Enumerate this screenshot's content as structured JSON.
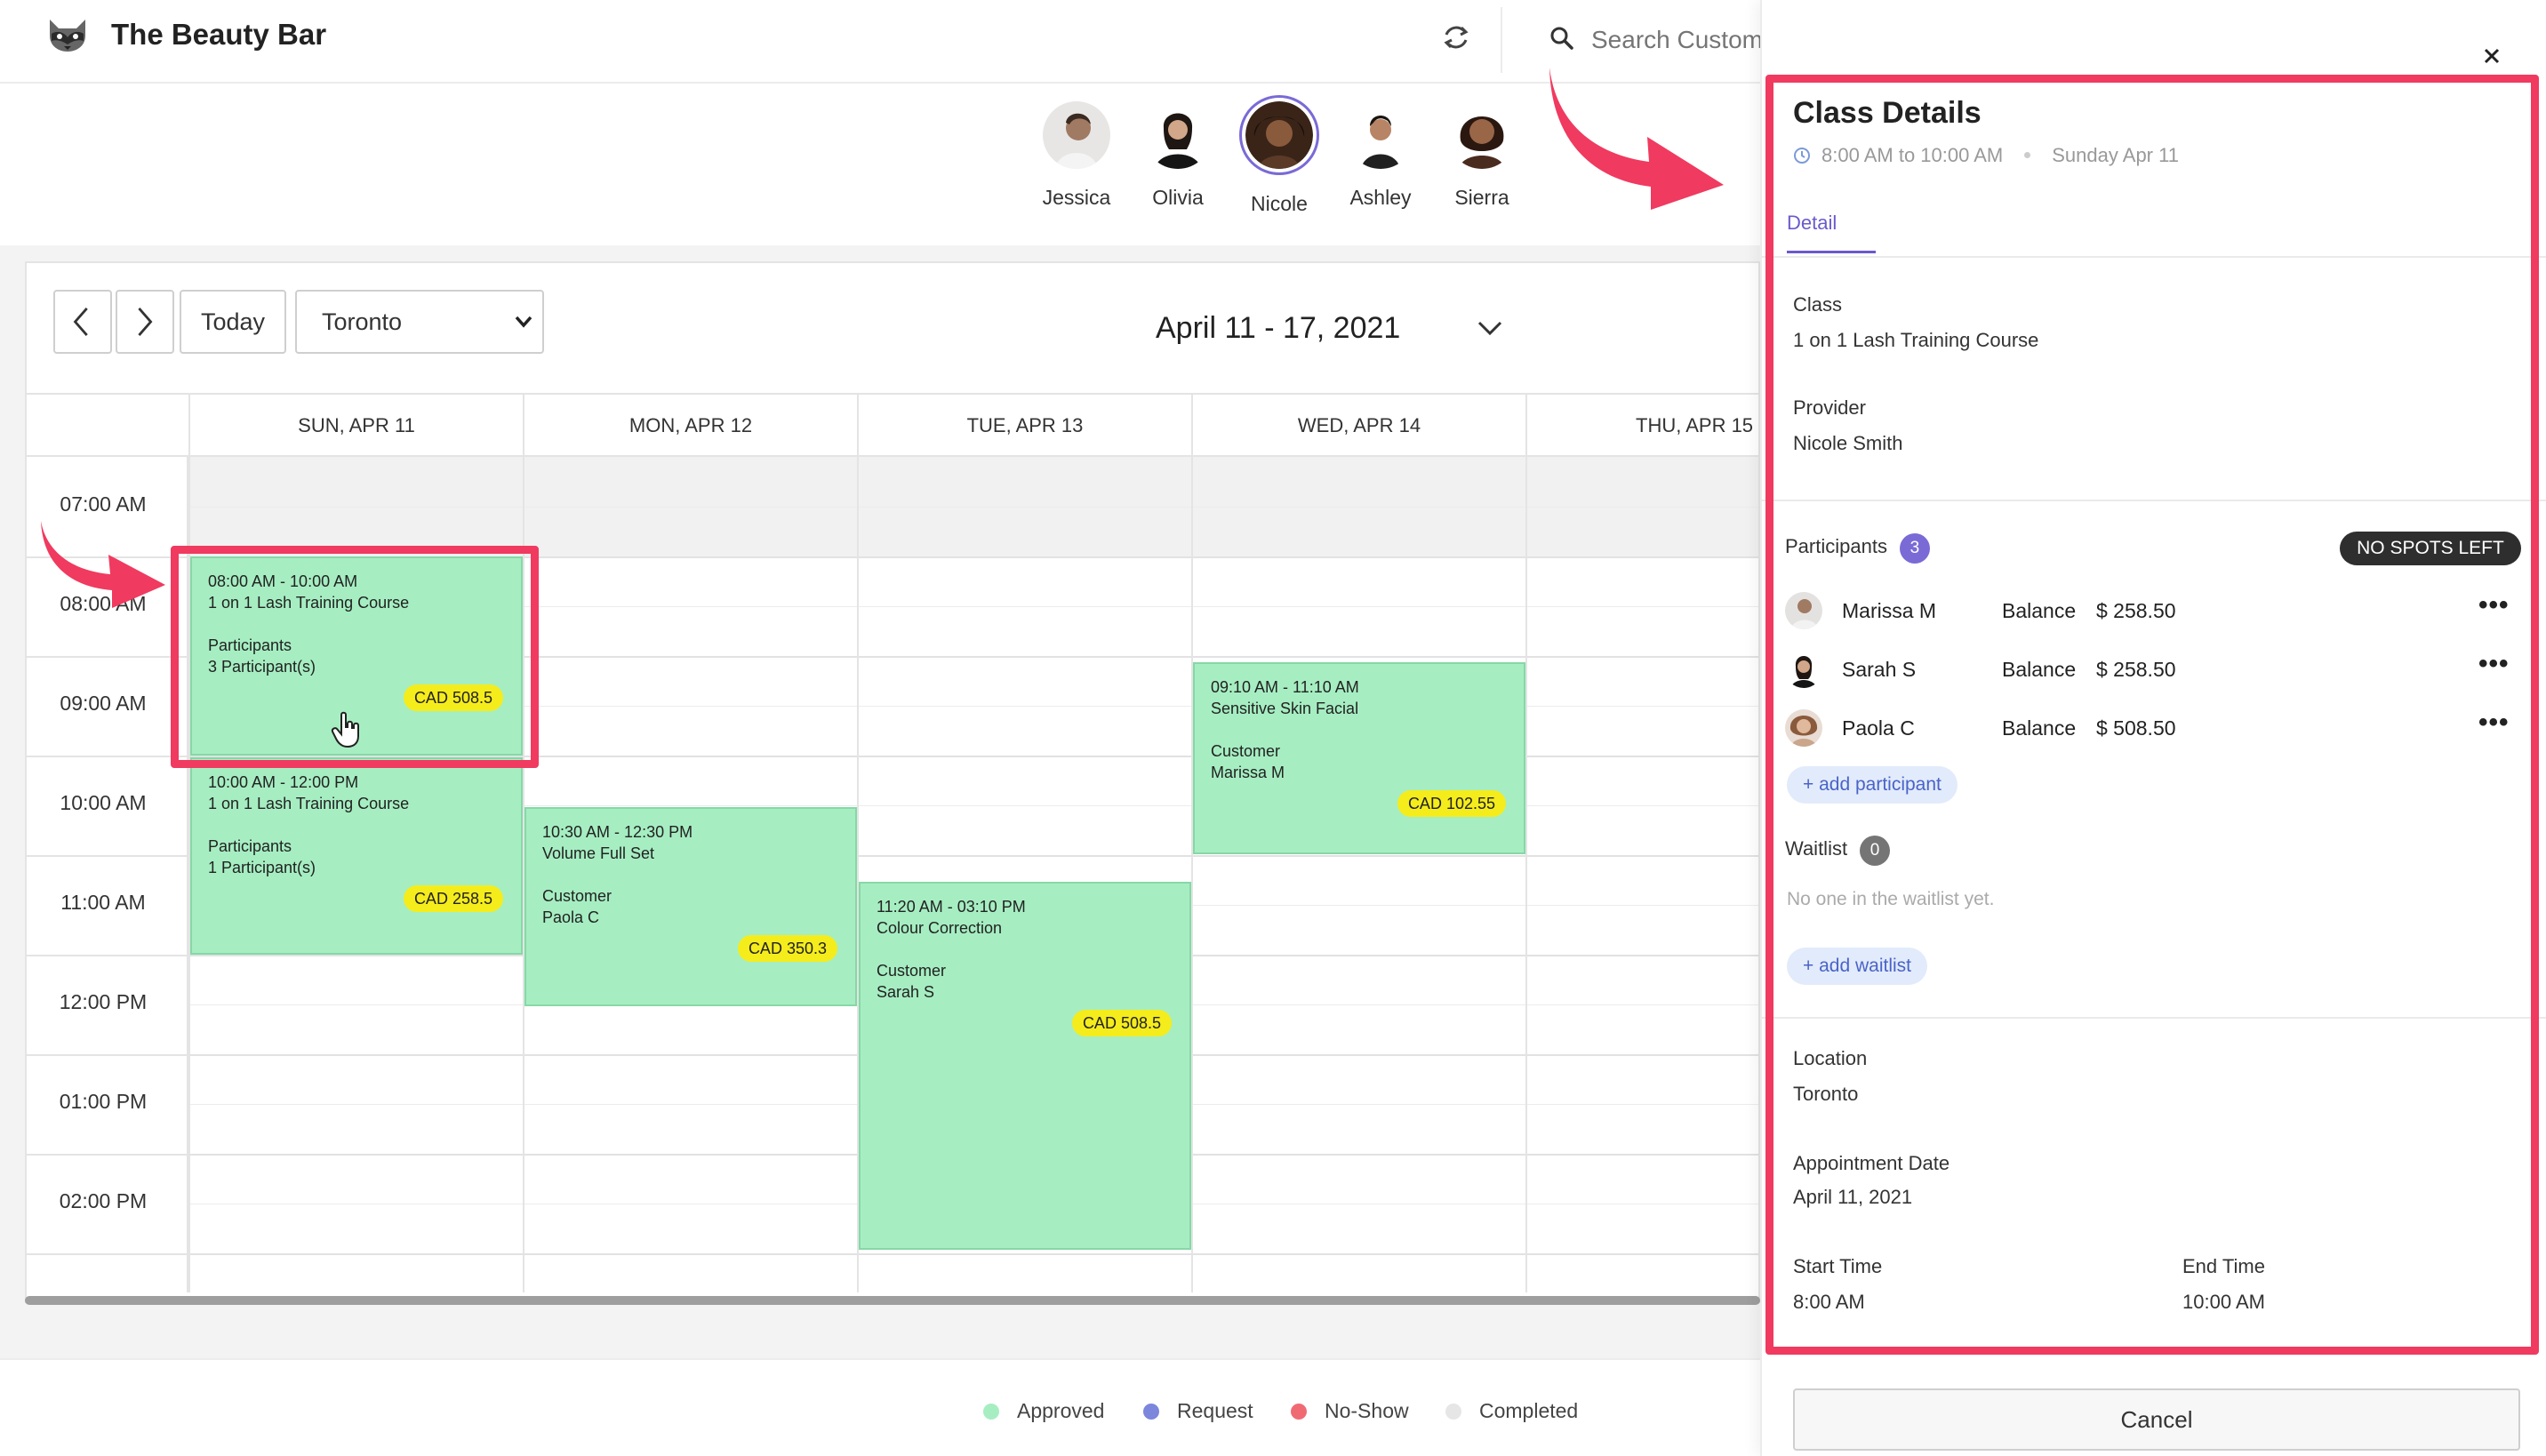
{
  "header": {
    "brand": "The Beauty Bar",
    "search_placeholder": "Search Customer",
    "icons": [
      "raccoon-logo-icon",
      "refresh-icon",
      "search-icon"
    ]
  },
  "providers": [
    {
      "name": "Jessica",
      "selected": false
    },
    {
      "name": "Olivia",
      "selected": false
    },
    {
      "name": "Nicole",
      "selected": true
    },
    {
      "name": "Ashley",
      "selected": false
    },
    {
      "name": "Sierra",
      "selected": false
    }
  ],
  "toolbar": {
    "prev_icon": "chevron-left-icon",
    "next_icon": "chevron-right-icon",
    "today_label": "Today",
    "location_value": "Toronto",
    "date_range": "April 11 - 17, 2021"
  },
  "calendar": {
    "days": [
      "SUN, APR 11",
      "MON, APR 12",
      "TUE, APR 13",
      "WED, APR 14",
      "THU, APR 15"
    ],
    "times": [
      "07:00 AM",
      "08:00 AM",
      "09:00 AM",
      "10:00 AM",
      "11:00 AM",
      "12:00 PM",
      "01:00 PM",
      "02:00 PM"
    ],
    "events": [
      {
        "time": "08:00 AM - 10:00 AM",
        "title": "1 on 1 Lash Training Course",
        "label": "Participants",
        "value": "3 Participant(s)",
        "price": "CAD 508.5"
      },
      {
        "time": "10:00 AM - 12:00 PM",
        "title": "1 on 1 Lash Training Course",
        "label": "Participants",
        "value": "1 Participant(s)",
        "price": "CAD 258.5"
      },
      {
        "time": "10:30 AM - 12:30 PM",
        "title": "Volume Full Set",
        "label": "Customer",
        "value": "Paola C",
        "price": "CAD 350.3"
      },
      {
        "time": "11:20 AM - 03:10 PM",
        "title": "Colour Correction",
        "label": "Customer",
        "value": "Sarah S",
        "price": "CAD 508.5"
      },
      {
        "time": "09:10 AM - 11:10 AM",
        "title": "Sensitive Skin Facial",
        "label": "Customer",
        "value": "Marissa M",
        "price": "CAD 102.55"
      }
    ]
  },
  "legend": [
    {
      "label": "Approved",
      "color": "#a6eec2"
    },
    {
      "label": "Request",
      "color": "#7b86dc"
    },
    {
      "label": "No-Show",
      "color": "#f06a74"
    },
    {
      "label": "Completed",
      "color": "#e6e6e6"
    }
  ],
  "panel": {
    "title": "Class Details",
    "time_range": "8:00 AM to 10:00 AM",
    "date": "Sunday Apr 11",
    "tab": "Detail",
    "class_label": "Class",
    "class_value": "1 on 1 Lash Training Course",
    "provider_label": "Provider",
    "provider_value": "Nicole Smith",
    "participants_label": "Participants",
    "participants_count": "3",
    "no_spots": "NO SPOTS LEFT",
    "participants": [
      {
        "name": "Marissa M",
        "balance_label": "Balance",
        "balance": "$ 258.50"
      },
      {
        "name": "Sarah S",
        "balance_label": "Balance",
        "balance": "$ 258.50"
      },
      {
        "name": "Paola C",
        "balance_label": "Balance",
        "balance": "$ 508.50"
      }
    ],
    "add_participant": "+ add participant",
    "waitlist_label": "Waitlist",
    "waitlist_count": "0",
    "waitlist_empty": "No one in the waitlist yet.",
    "add_waitlist": "+ add waitlist",
    "location_label": "Location",
    "location_value": "Toronto",
    "appt_date_label": "Appointment Date",
    "appt_date_value": "April 11, 2021",
    "start_label": "Start Time",
    "start_value": "8:00 AM",
    "end_label": "End Time",
    "end_value": "10:00 AM",
    "cancel_label": "Cancel"
  },
  "colors": {
    "accent": "#6a5acd",
    "annotation": "#f03a5f",
    "event_green": "#a6eec2",
    "price_tag": "#f5ec1c"
  }
}
